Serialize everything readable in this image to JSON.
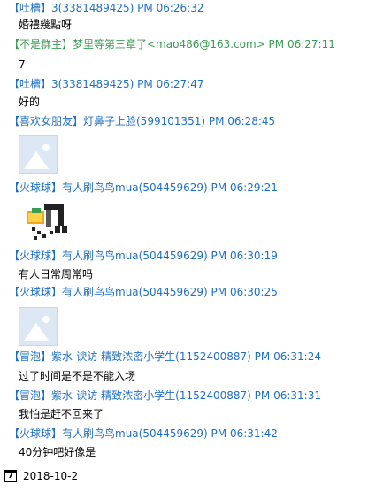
{
  "colors": {
    "blue": "#1e6fc7",
    "green": "#3a9b52",
    "text": "#000000"
  },
  "messages": [
    {
      "header": "【吐槽】3(3381489425) PM 06:26:32",
      "color": "#1e6fc7",
      "content": "婚禮幾點呀",
      "type": "text"
    },
    {
      "header": "【不是群主】梦里等第三章了<mao486@163.com> PM 06:27:11",
      "color": "#3a9b52",
      "content": "7",
      "type": "text"
    },
    {
      "header": "【吐槽】3(3381489425) PM 06:27:47",
      "color": "#1e6fc7",
      "content": "好的",
      "type": "text"
    },
    {
      "header": "【喜欢女朋友】灯鼻子上脸(599101351) PM 06:28:45",
      "color": "#1e6fc7",
      "content": "",
      "type": "image"
    },
    {
      "header": "【火球球】有人刷鸟鸟mua(504459629) PM 06:29:21",
      "color": "#1e6fc7",
      "content": "",
      "type": "emoji"
    },
    {
      "header": "【火球球】有人刷鸟鸟mua(504459629) PM 06:30:19",
      "color": "#1e6fc7",
      "content": "有人日常周常吗",
      "type": "text"
    },
    {
      "header": "【火球球】有人刷鸟鸟mua(504459629) PM 06:30:25",
      "color": "#1e6fc7",
      "content": "",
      "type": "image"
    },
    {
      "header": "【冒泡】紫水-谀访  精致浓密小学生(1152400887) PM 06:31:24",
      "color": "#1e6fc7",
      "content": "过了时间是不是不能入场",
      "type": "text"
    },
    {
      "header": "【冒泡】紫水-谀访  精致浓密小学生(1152400887) PM 06:31:31",
      "color": "#1e6fc7",
      "content": "我怕是赶不回来了",
      "type": "text"
    },
    {
      "header": "【火球球】有人刷鸟鸟mua(504459629) PM 06:31:42",
      "color": "#1e6fc7",
      "content": "40分钟吧好像是",
      "type": "text"
    }
  ],
  "footer": {
    "calendar_icon": "calendar-icon",
    "calendar_day": "7",
    "date": "2018-10-2"
  }
}
